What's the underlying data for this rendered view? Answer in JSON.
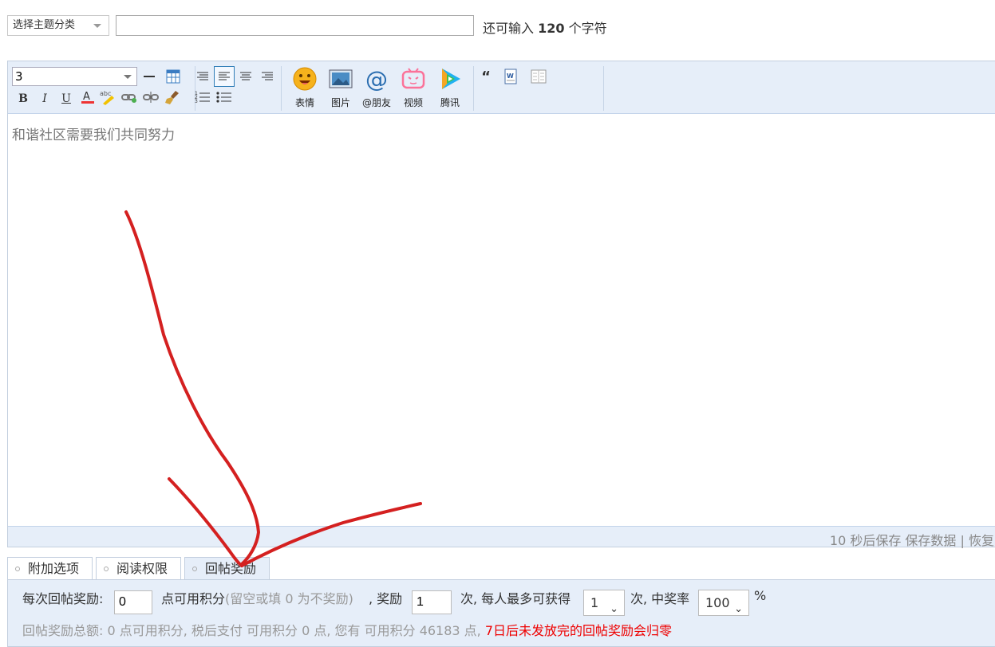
{
  "topic_select": {
    "label": "选择主题分类"
  },
  "subject": {
    "value": "",
    "remaining_prefix": "还可输入",
    "remaining_count": "120",
    "remaining_suffix": "个字符"
  },
  "toolbar": {
    "font_size": "3",
    "media": [
      {
        "icon": "smiley-icon",
        "label": "表情"
      },
      {
        "icon": "image-icon",
        "label": "图片"
      },
      {
        "icon": "at-icon",
        "label": "@朋友"
      },
      {
        "icon": "bilibili-icon",
        "label": "视频"
      },
      {
        "icon": "tencent-video-icon",
        "label": "腾讯"
      }
    ]
  },
  "editor": {
    "placeholder": "和谐社区需要我们共同努力"
  },
  "footer": {
    "status": "10 秒后保存 保存数据 | 恢复"
  },
  "tabs": [
    {
      "label": "附加选项",
      "active": false
    },
    {
      "label": "阅读权限",
      "active": false
    },
    {
      "label": "回帖奖励",
      "active": true
    }
  ],
  "reward": {
    "per_reply_label": "每次回帖奖励:",
    "per_reply_value": "0",
    "unit_text": "点可用积分",
    "hint": "(留空或填 0 为不奖励)",
    "reward_label": ", 奖励",
    "reward_times": "1",
    "per_person_label": "次, 每人最多可获得",
    "max_times": "1",
    "rate_label": "次, 中奖率",
    "rate": "100",
    "percent": "%",
    "summary": "回帖奖励总额: 0 点可用积分, 税后支付 可用积分 0 点, 您有 可用积分 46183 点,",
    "warning": "7日后未发放完的回帖奖励会归零"
  },
  "colors": {
    "accent": "#2f7db7",
    "toolbar_bg": "#e6eef9",
    "warning": "#ee0000",
    "annotation": "#d42020"
  }
}
